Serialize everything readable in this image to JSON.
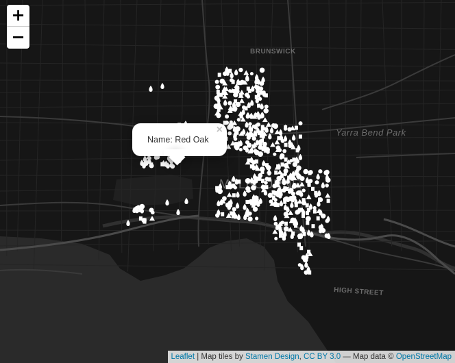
{
  "map": {
    "zoom_in_label": "+",
    "zoom_out_label": "−",
    "labels": {
      "brunswick": "BRUNSWICK",
      "yarra_bend_park": "Yarra Bend Park",
      "high_street": "HIGH STREET",
      "melbourne": "MELBOURNE"
    },
    "marker_color": "#ffffff",
    "background_color": "#151515",
    "water_color": "#2b2b2b"
  },
  "popup": {
    "text": "Name: Red Oak",
    "close_label": "×"
  },
  "attribution": {
    "leaflet": "Leaflet",
    "sep1": " | Map tiles by ",
    "stamen": "Stamen Design",
    "comma": ", ",
    "license": "CC BY 3.0",
    "sep2": " — Map data © ",
    "osm": "OpenStreetMap"
  }
}
